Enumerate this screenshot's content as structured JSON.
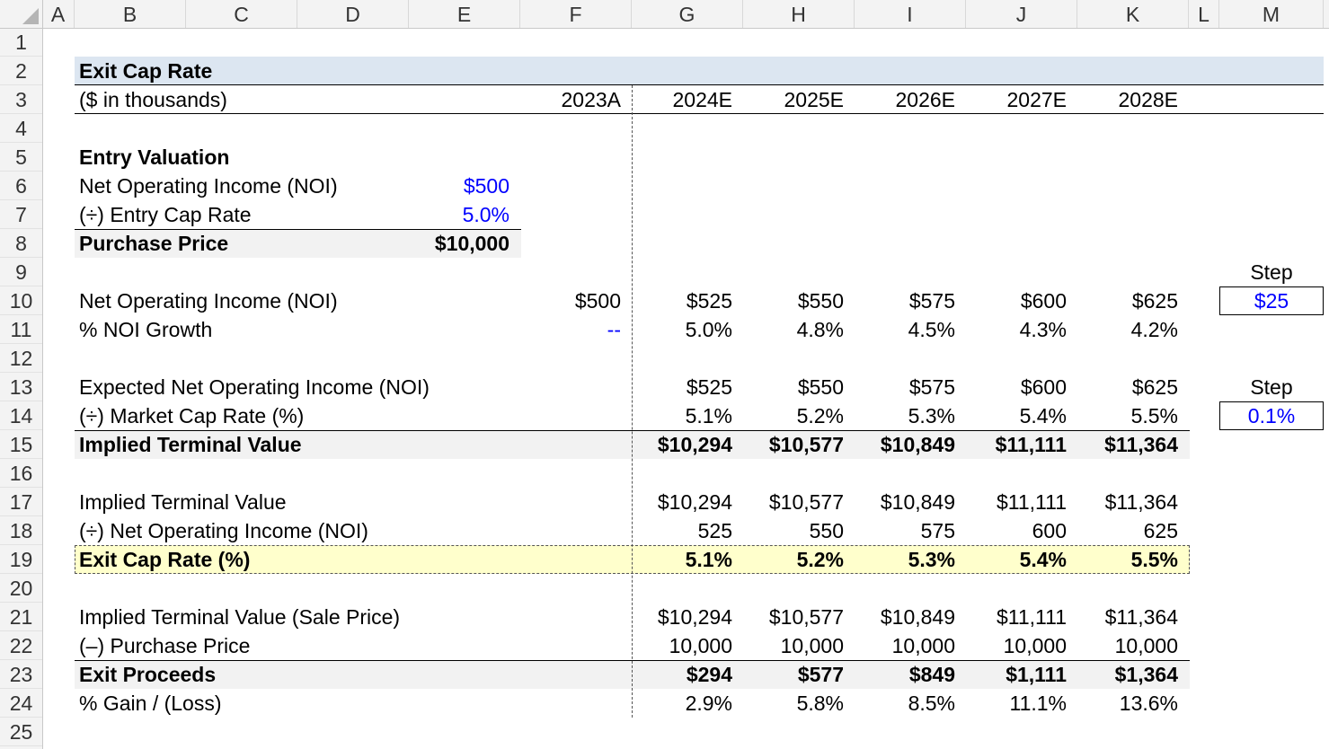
{
  "columns": [
    "A",
    "B",
    "C",
    "D",
    "E",
    "F",
    "G",
    "H",
    "I",
    "J",
    "K",
    "L",
    "M"
  ],
  "rows": [
    "1",
    "2",
    "3",
    "4",
    "5",
    "6",
    "7",
    "8",
    "9",
    "10",
    "11",
    "12",
    "13",
    "14",
    "15",
    "16",
    "17",
    "18",
    "19",
    "20",
    "21",
    "22",
    "23",
    "24",
    "25"
  ],
  "title": "Exit Cap Rate",
  "units": "($ in thousands)",
  "years": [
    "2023A",
    "2024E",
    "2025E",
    "2026E",
    "2027E",
    "2028E"
  ],
  "entry": {
    "heading": "Entry Valuation",
    "noi_label": "Net Operating Income (NOI)",
    "noi_value": "$500",
    "cap_label": "(÷) Entry Cap Rate",
    "cap_value": "5.0%",
    "price_label": "Purchase Price",
    "price_value": "$10,000"
  },
  "step_label": "Step",
  "step_noi": "$25",
  "step_cap": "0.1%",
  "lines": [
    {
      "row": 10,
      "label": "Net Operating Income (NOI)",
      "values": [
        "$500",
        "$525",
        "$550",
        "$575",
        "$600",
        "$625"
      ]
    },
    {
      "row": 11,
      "label": "% NOI Growth",
      "values": [
        "--",
        "5.0%",
        "4.8%",
        "4.5%",
        "4.3%",
        "4.2%"
      ]
    },
    {
      "row": 13,
      "label": "Expected Net Operating Income (NOI)",
      "values": [
        "",
        "$525",
        "$550",
        "$575",
        "$600",
        "$625"
      ]
    },
    {
      "row": 14,
      "label": "(÷) Market Cap Rate (%)",
      "values": [
        "",
        "5.1%",
        "5.2%",
        "5.3%",
        "5.4%",
        "5.5%"
      ]
    },
    {
      "row": 15,
      "label": "Implied Terminal Value",
      "values": [
        "",
        "$10,294",
        "$10,577",
        "$10,849",
        "$11,111",
        "$11,364"
      ]
    },
    {
      "row": 17,
      "label": "Implied Terminal Value",
      "values": [
        "",
        "$10,294",
        "$10,577",
        "$10,849",
        "$11,111",
        "$11,364"
      ]
    },
    {
      "row": 18,
      "label": "(÷) Net Operating Income (NOI)",
      "values": [
        "",
        "525",
        "550",
        "575",
        "600",
        "625"
      ]
    },
    {
      "row": 19,
      "label": "Exit Cap Rate (%)",
      "values": [
        "",
        "5.1%",
        "5.2%",
        "5.3%",
        "5.4%",
        "5.5%"
      ]
    },
    {
      "row": 21,
      "label": "Implied Terminal Value (Sale Price)",
      "values": [
        "",
        "$10,294",
        "$10,577",
        "$10,849",
        "$11,111",
        "$11,364"
      ]
    },
    {
      "row": 22,
      "label": "(–) Purchase Price",
      "values": [
        "",
        "10,000",
        "10,000",
        "10,000",
        "10,000",
        "10,000"
      ]
    },
    {
      "row": 23,
      "label": "Exit Proceeds",
      "values": [
        "",
        "$294",
        "$577",
        "$849",
        "$1,111",
        "$1,364"
      ]
    },
    {
      "row": 24,
      "label": "% Gain / (Loss)",
      "values": [
        "",
        "2.9%",
        "5.8%",
        "8.5%",
        "11.1%",
        "13.6%"
      ]
    }
  ],
  "colors": {
    "title_band": "#dce6f1",
    "total_band": "#f2f2f2",
    "highlight": "#ffffcc",
    "input_blue": "#0000ff"
  }
}
